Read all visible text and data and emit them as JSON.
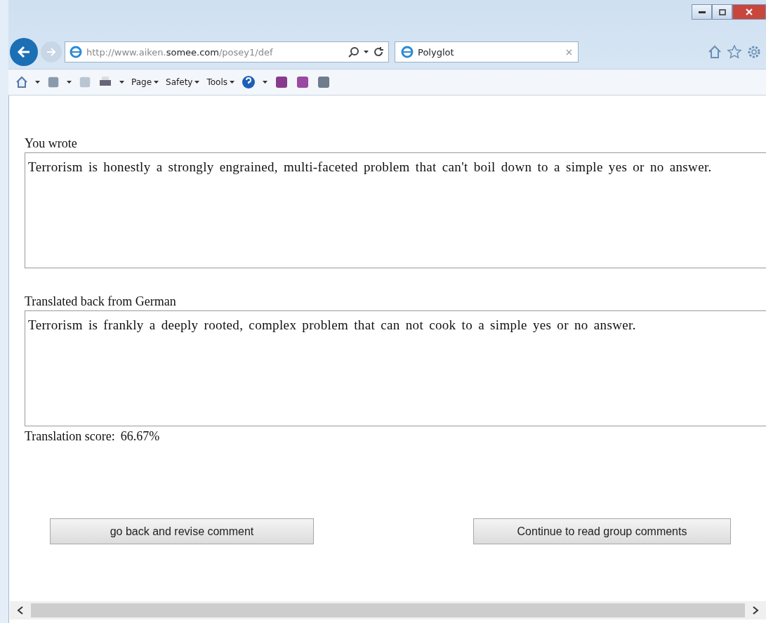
{
  "address_bar": {
    "url_prefix": "http://www.aiken.",
    "url_domain": "somee.com",
    "url_suffix": "/posey1/def"
  },
  "tab": {
    "title": "Polyglot",
    "selected": true
  },
  "command_bar": {
    "menus": [
      "Page",
      "Safety",
      "Tools"
    ]
  },
  "page": {
    "fields": [
      {
        "label": "You wrote",
        "value": "Terrorism is honestly a strongly engrained, multi-faceted problem that can't boil down to a simple yes or no answer."
      },
      {
        "label": "Translated back from German",
        "value": "Terrorism is frankly a deeply rooted, complex problem that can not cook to a simple yes or no answer."
      }
    ],
    "score": {
      "label": "Translation score:",
      "value": "66.67%"
    },
    "buttons": [
      "go back and revise comment",
      "Continue to read group comments"
    ]
  }
}
